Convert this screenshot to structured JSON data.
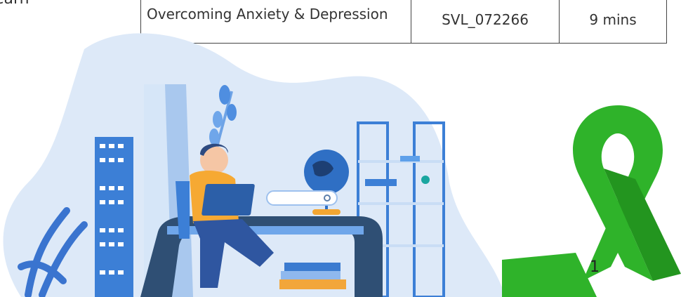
{
  "left_text": "earn",
  "course_row": {
    "title": "Overcoming Anxiety & Depression",
    "code": "SVL_072266",
    "duration": "9 mins"
  },
  "page_number": "1",
  "colors": {
    "blob": "#dbe8f7",
    "ribbon": "#2fb32a",
    "desk": "#2d4c6f",
    "shirt": "#f6a933",
    "laptop": "#2c5fa8"
  }
}
